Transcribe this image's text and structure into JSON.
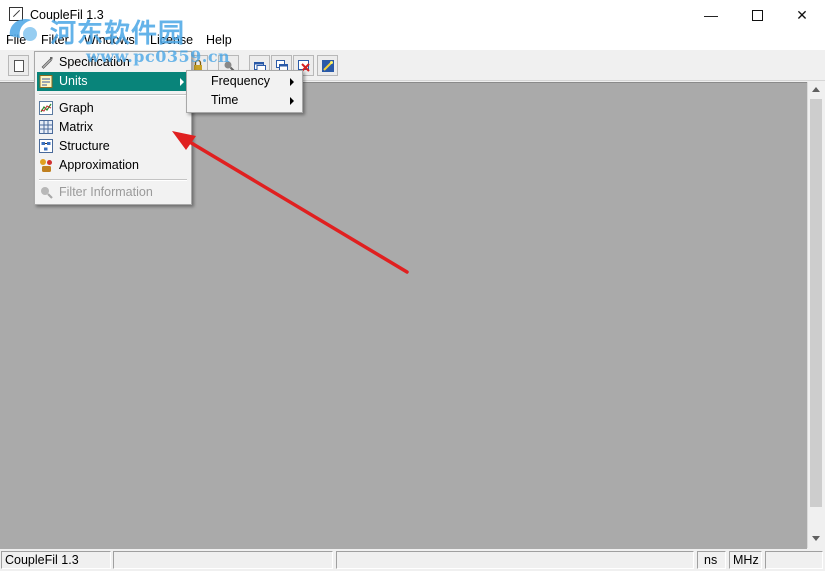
{
  "window": {
    "title": "CoupleFil 1.3",
    "controls": {
      "minimize": "—",
      "maximize": "□",
      "close": "✕"
    }
  },
  "watermark": {
    "line1": "河东软件园",
    "line2": "www.pc0359.cn"
  },
  "menubar": {
    "items": [
      "File",
      "Filter",
      "Windows",
      "License",
      "Help"
    ]
  },
  "toolbar": {
    "buttons": [
      "new-icon",
      "lock-icon",
      "search-icon",
      "window-icon",
      "cascade-icon",
      "close-window-icon",
      "wand-icon"
    ]
  },
  "filter_menu": {
    "items": [
      {
        "label": "Specification",
        "icon": "spec-icon",
        "submenu": false
      },
      {
        "label": "Units",
        "icon": "units-icon",
        "submenu": true,
        "selected": true
      },
      {
        "label": "Graph",
        "icon": "graph-icon"
      },
      {
        "label": "Matrix",
        "icon": "matrix-icon"
      },
      {
        "label": "Structure",
        "icon": "structure-icon"
      },
      {
        "label": "Approximation",
        "icon": "approximation-icon"
      },
      {
        "label": "Filter Information",
        "icon": "info-search-icon",
        "disabled": true
      }
    ]
  },
  "units_submenu": {
    "items": [
      {
        "label": "Frequency",
        "submenu": true
      },
      {
        "label": "Time",
        "submenu": true
      }
    ]
  },
  "statusbar": {
    "app": "CoupleFil 1.3",
    "panel2": "",
    "panel3": "",
    "time_unit": "ns",
    "freq_unit": "MHz",
    "panel6": ""
  },
  "colors": {
    "highlight": "#09847a",
    "mdi_background": "#aaaaaa",
    "annotation_arrow": "#e02020",
    "watermark": "#4aa6e6"
  }
}
